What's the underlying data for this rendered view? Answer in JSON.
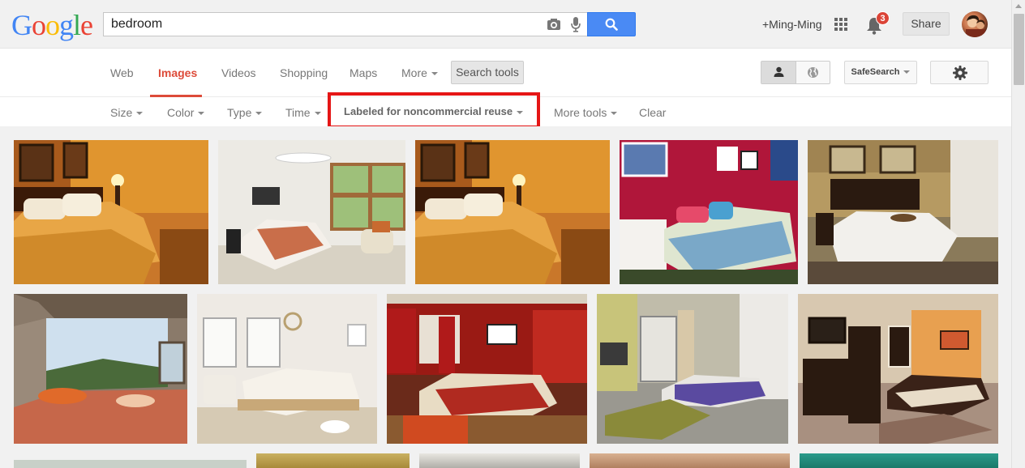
{
  "search": {
    "query": "bedroom"
  },
  "header": {
    "user_link": "+Ming-Ming",
    "notification_count": "3",
    "share_label": "Share"
  },
  "nav": {
    "tabs": [
      {
        "label": "Web"
      },
      {
        "label": "Images"
      },
      {
        "label": "Videos"
      },
      {
        "label": "Shopping"
      },
      {
        "label": "Maps"
      },
      {
        "label": "More"
      }
    ],
    "active_tab": "Images",
    "search_tools_label": "Search tools",
    "safesearch_label": "SafeSearch"
  },
  "tools": {
    "size": "Size",
    "color": "Color",
    "type": "Type",
    "time": "Time",
    "license": "Labeled for noncommercial reuse",
    "more_tools": "More tools",
    "clear": "Clear"
  },
  "colors": {
    "accent_red": "#dd4b39",
    "search_blue": "#4a8af4",
    "highlight_border": "#e51616"
  },
  "icons": [
    "camera-icon",
    "mic-icon",
    "search-icon",
    "apps-grid-icon",
    "bell-icon",
    "person-icon",
    "globe-icon",
    "gear-icon"
  ]
}
